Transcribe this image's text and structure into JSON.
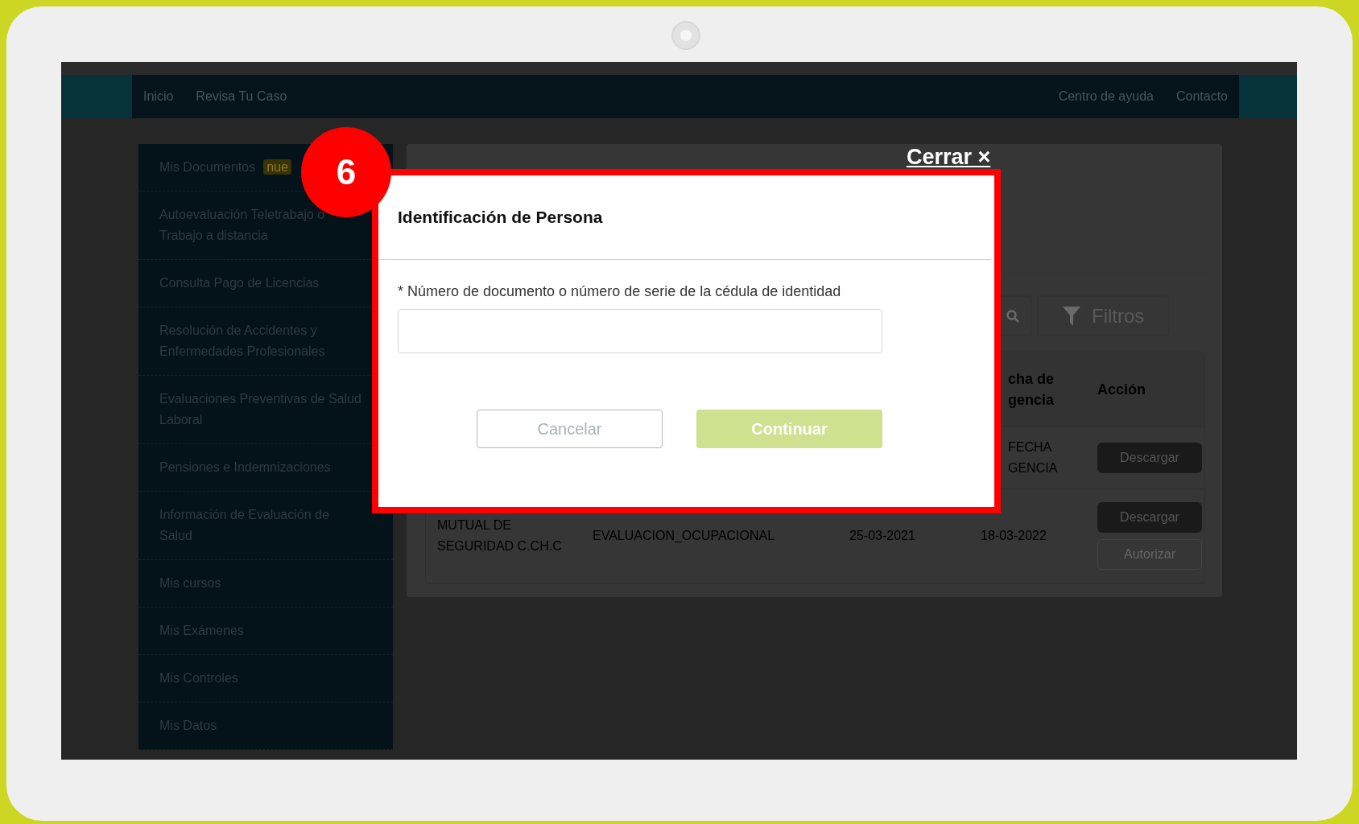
{
  "navbar": {
    "left_links": [
      "Inicio",
      "Revisa Tu Caso"
    ],
    "right_links": [
      "Centro de ayuda",
      "Contacto"
    ]
  },
  "sidebar": {
    "items": [
      {
        "label": "Mis Documentos",
        "badge": "nue"
      },
      {
        "label": "Autoevaluación Teletrabajo o Trabajo a distancia"
      },
      {
        "label": "Consulta Pago de Licencias"
      },
      {
        "label": "Resolución de Accidentes y Enfermedades Profesionales"
      },
      {
        "label": "Evaluaciones Preventivas de Salud Laboral"
      },
      {
        "label": "Pensiones e Indemnizaciones"
      },
      {
        "label": "Información de Evaluación de Salud"
      },
      {
        "label": "Mis cursos"
      },
      {
        "label": "Mis Exámenes"
      },
      {
        "label": "Mis Controles"
      },
      {
        "label": "Mis Datos"
      }
    ]
  },
  "toolbar": {
    "filter_button": "Filtros"
  },
  "table": {
    "header_fragment": "cha de gencia",
    "action_header": "Acción",
    "rows": [
      {
        "fragment": "FECHA GENCIA",
        "actions": [
          {
            "label": "Descargar",
            "kind": "filled"
          }
        ]
      },
      {
        "cells": [
          "MUTUAL DE SEGURIDAD C.CH.C",
          "EVALUACION_OCUPACIONAL",
          "25-03-2021",
          "18-03-2022"
        ],
        "actions": [
          {
            "label": "Descargar",
            "kind": "filled"
          },
          {
            "label": "Autorizar",
            "kind": "outline"
          }
        ]
      }
    ]
  },
  "modal": {
    "close_label": "Cerrar ×",
    "step": "6",
    "title": "Identificación de Persona",
    "field_label": "* Número de documento o número de serie de la cédula de identidad",
    "buttons": [
      {
        "label": "Cancelar",
        "kind": "secondary"
      },
      {
        "label": "Continuar",
        "kind": "primary"
      }
    ]
  }
}
